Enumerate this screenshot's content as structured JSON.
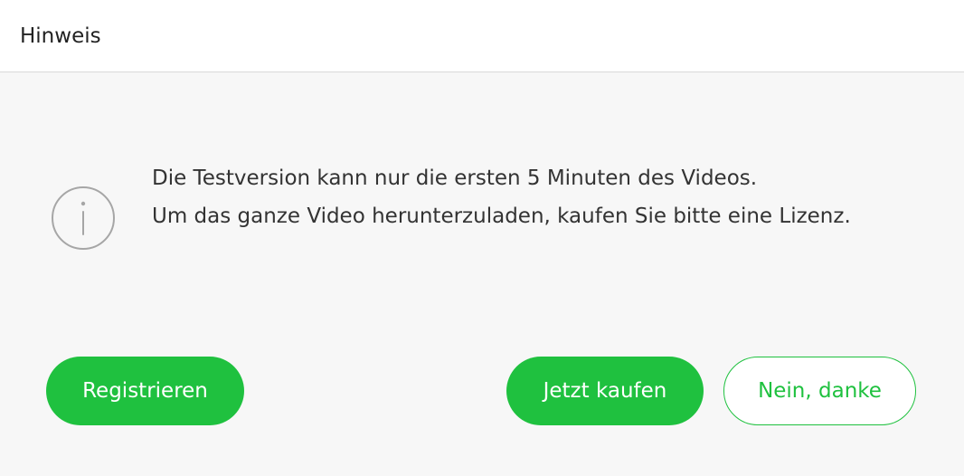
{
  "dialog": {
    "title": "Hinweis",
    "icon": "info-icon",
    "message_line1": "Die Testversion kann nur die ersten 5 Minuten des Videos.",
    "message_line2": "Um das ganze Video herunterzuladen, kaufen Sie bitte eine Lizenz."
  },
  "buttons": {
    "register_label": "Registrieren",
    "buy_label": "Jetzt kaufen",
    "decline_label": "Nein, danke"
  },
  "colors": {
    "accent": "#1fc13f",
    "background": "#f7f7f7",
    "titlebar": "#ffffff",
    "icon": "#a6a6a6"
  }
}
